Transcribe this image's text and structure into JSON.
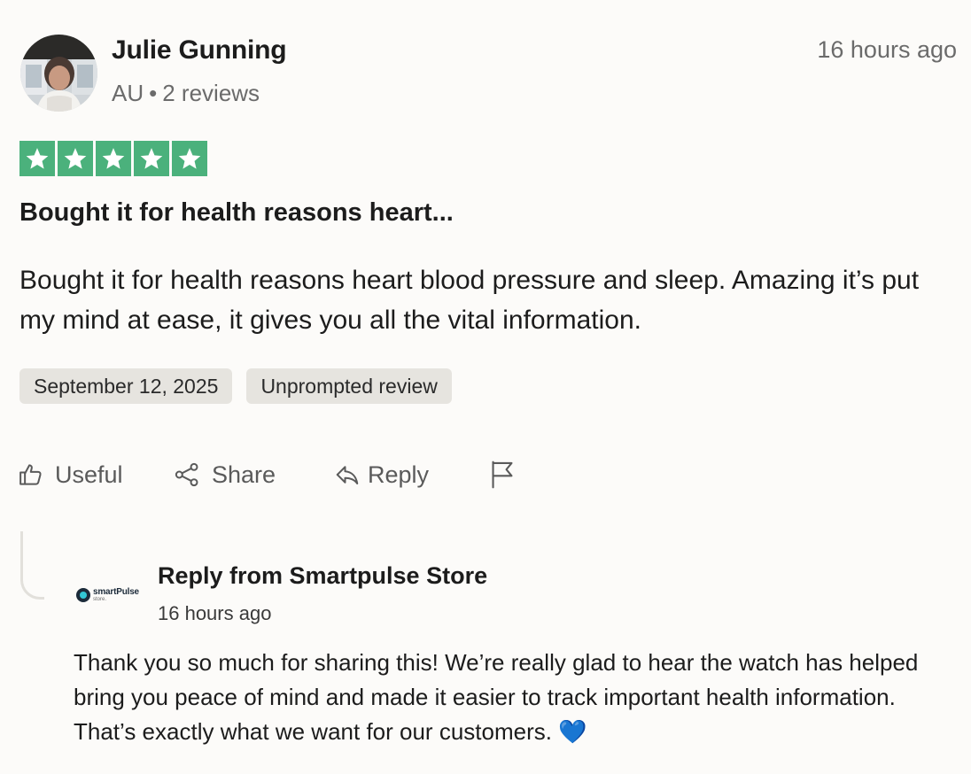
{
  "review": {
    "reviewer": {
      "name": "Julie Gunning",
      "country": "AU",
      "separator": "•",
      "review_count": "2 reviews"
    },
    "posted_ago": "16 hours ago",
    "rating": 5,
    "star_color": "#4bb17c",
    "title": "Bought it for health reasons heart...",
    "body": "Bought it for health reasons heart blood pressure and sleep. Amazing it’s put my mind at ease, it gives you all the vital information.",
    "tags": {
      "date": "September 12, 2025",
      "review_type": "Unprompted review"
    }
  },
  "actions": {
    "useful": {
      "label": "Useful",
      "icon": "thumbs-up-icon"
    },
    "share": {
      "label": "Share",
      "icon": "share-icon"
    },
    "reply": {
      "label": "Reply",
      "icon": "reply-arrow-icon"
    },
    "report": {
      "icon": "flag-icon"
    }
  },
  "company_reply": {
    "logo": {
      "name": "smartPulse",
      "sub": "store."
    },
    "title": "Reply from Smartpulse Store",
    "posted_ago": "16 hours ago",
    "body": "Thank you so much for sharing this! We’re really glad to hear the watch has helped bring you peace of mind and made it easier to track important health information. That’s exactly what we want for our customers. 💙"
  }
}
